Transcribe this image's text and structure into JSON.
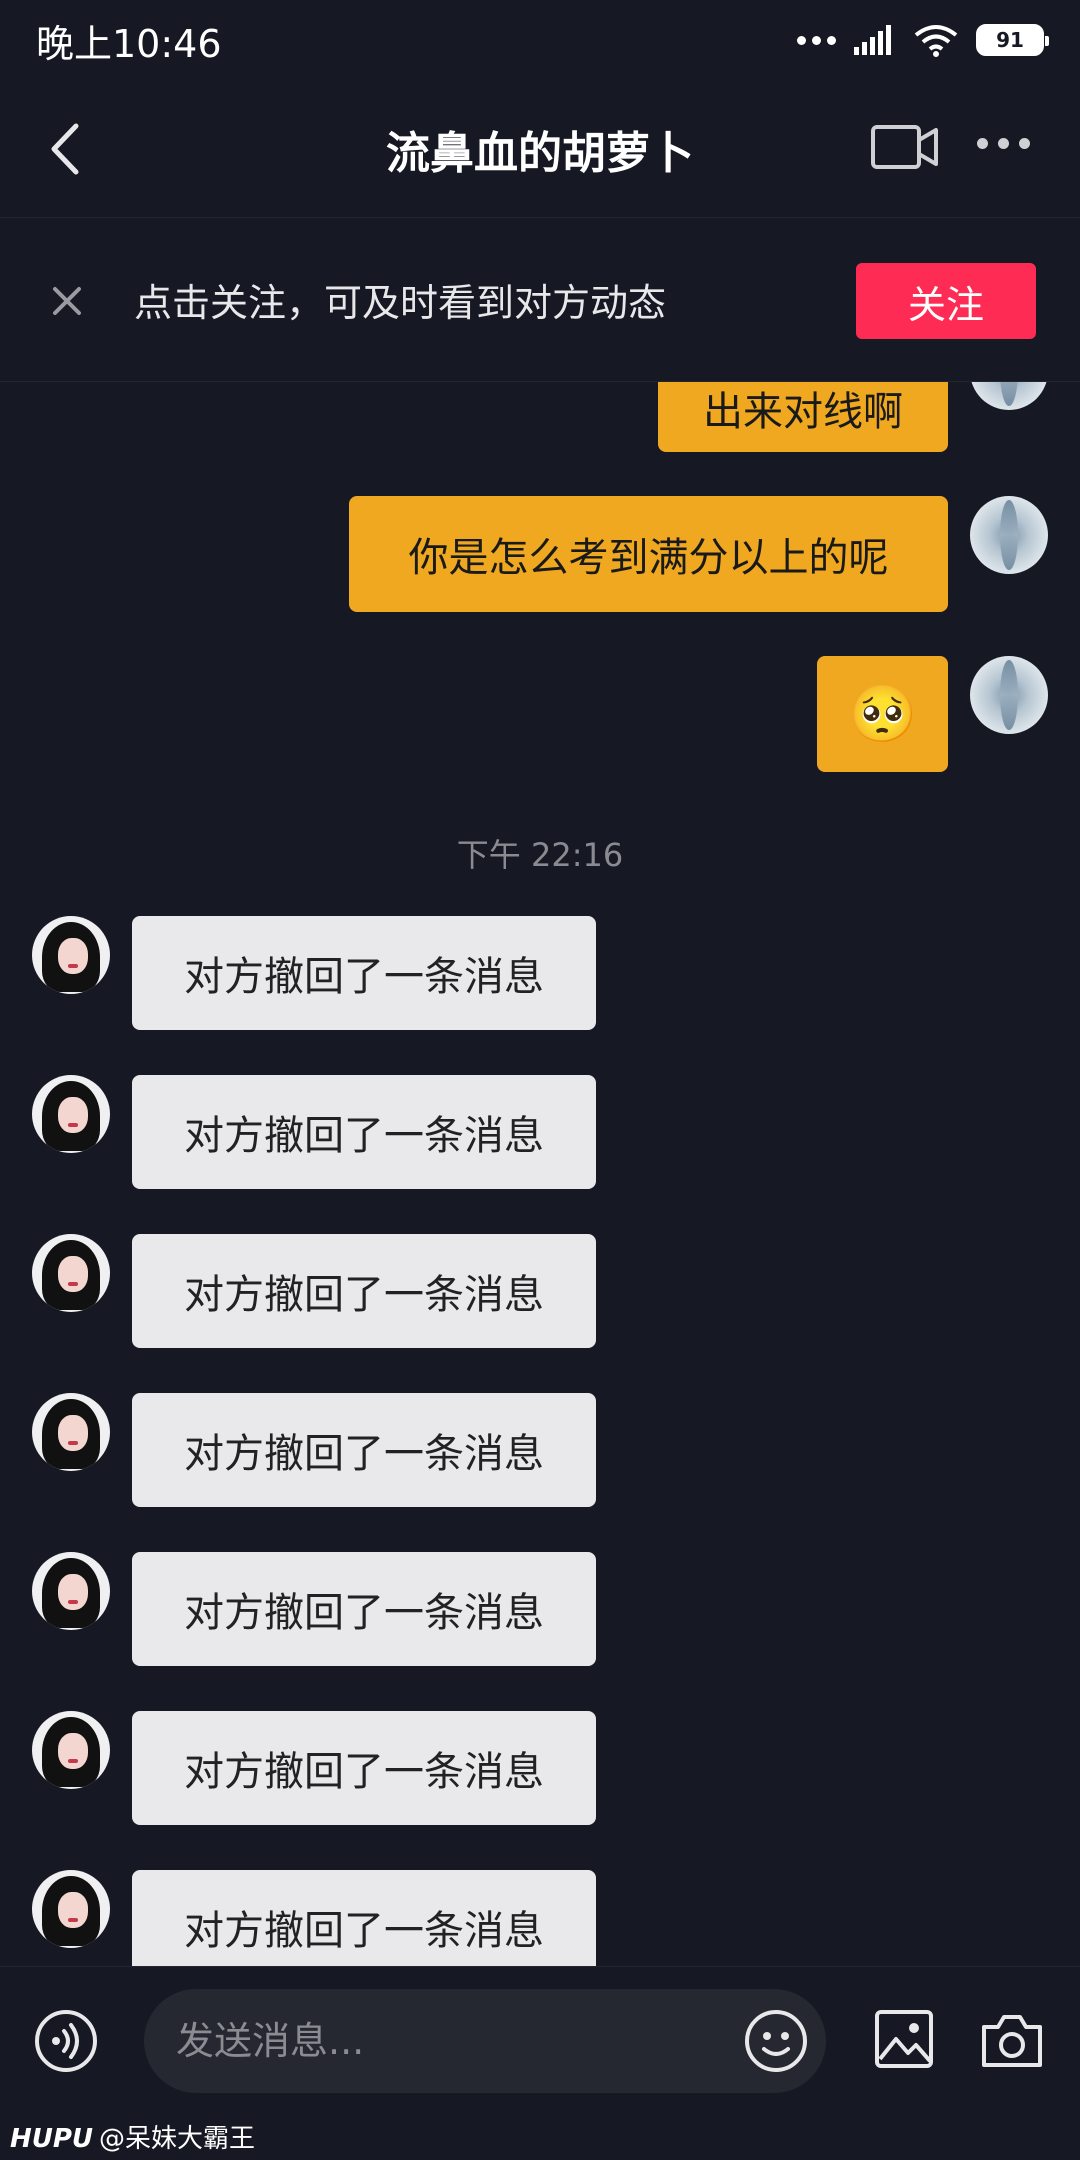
{
  "status_bar": {
    "time": "晚上10:46",
    "battery": "91"
  },
  "header": {
    "title": "流鼻血的胡萝卜"
  },
  "follow_banner": {
    "text": "点击关注，可及时看到对方动态",
    "button": "关注"
  },
  "messages": {
    "sent": [
      {
        "text": "出来对线啊"
      },
      {
        "text": "你是怎么考到满分以上的呢"
      },
      {
        "text": "🥺"
      }
    ],
    "timestamp": "下午 22:16",
    "received": [
      {
        "text": "对方撤回了一条消息"
      },
      {
        "text": "对方撤回了一条消息"
      },
      {
        "text": "对方撤回了一条消息"
      },
      {
        "text": "对方撤回了一条消息"
      },
      {
        "text": "对方撤回了一条消息"
      },
      {
        "text": "对方撤回了一条消息"
      },
      {
        "text": "对方撤回了一条消息"
      }
    ]
  },
  "input_bar": {
    "placeholder": "发送消息..."
  },
  "watermark": {
    "brand": "HUPU",
    "user": "@呆妹大霸王"
  },
  "colors": {
    "background": "#161823",
    "sent_bubble": "#efa820",
    "received_bubble": "#e9e9ec",
    "follow_button": "#fe2c55"
  },
  "icons": [
    "back-icon",
    "video-call-icon",
    "more-icon",
    "close-icon",
    "voice-icon",
    "emoji-icon",
    "image-icon",
    "camera-icon"
  ]
}
